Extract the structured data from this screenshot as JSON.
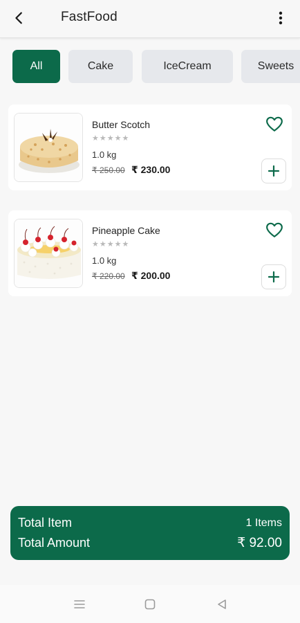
{
  "appbar": {
    "title": "FastFood",
    "back_icon": "arrow-back-icon",
    "menu_icon": "more-vertical-icon"
  },
  "categories": [
    {
      "label": "All",
      "active": true
    },
    {
      "label": "Cake",
      "active": false
    },
    {
      "label": "IceCream",
      "active": false
    },
    {
      "label": "Sweets",
      "active": false
    }
  ],
  "products": [
    {
      "name": "Butter Scotch",
      "stars": "★★★★★",
      "weight": "1.0 kg",
      "old_price": "₹ 250.00",
      "price": "₹ 230.00"
    },
    {
      "name": "Pineapple Cake",
      "stars": "★★★★★",
      "weight": "1.0 kg",
      "old_price": "₹ 220.00",
      "price": "₹ 200.00"
    }
  ],
  "summary": {
    "total_item_label": "Total Item",
    "total_item_value": "1 Items",
    "total_amount_label": "Total Amount",
    "total_amount_value": "₹ 92.00"
  },
  "colors": {
    "primary": "#0c6a4a",
    "chip_bg": "#e6e8ec",
    "background": "#f7f7f7"
  }
}
